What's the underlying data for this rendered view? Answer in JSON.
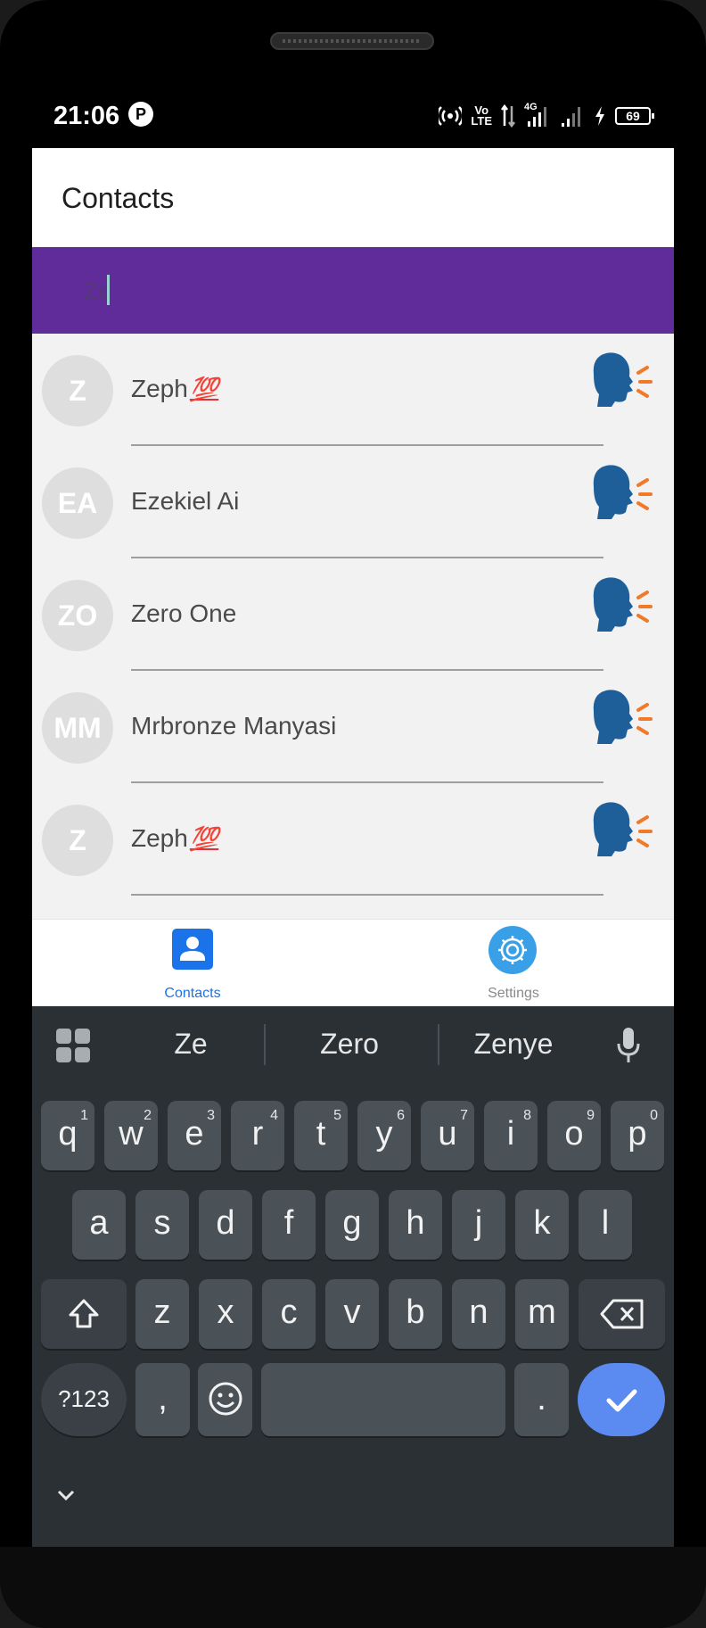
{
  "statusbar": {
    "time": "21:06",
    "notif_glyph": "P",
    "network_top": "Vo",
    "network_bottom": "LTE",
    "network_type": "4G",
    "battery": "69"
  },
  "appbar": {
    "title": "Contacts"
  },
  "search": {
    "value": "Ze",
    "placeholder": ""
  },
  "contacts": [
    {
      "initials": "Z",
      "name": "Zeph",
      "emoji": "💯"
    },
    {
      "initials": "EA",
      "name": "Ezekiel Ai",
      "emoji": ""
    },
    {
      "initials": "ZO",
      "name": "Zero  One",
      "emoji": ""
    },
    {
      "initials": "MM",
      "name": "Mrbronze Manyasi",
      "emoji": ""
    },
    {
      "initials": "Z",
      "name": "Zeph",
      "emoji": "💯"
    }
  ],
  "tabs": [
    {
      "label": "Contacts",
      "active": true,
      "color": "#1a73e8"
    },
    {
      "label": "Settings",
      "active": false,
      "color": "#8a8a8a"
    }
  ],
  "keyboard": {
    "suggestions": [
      "Ze",
      "Zero",
      "Zenye"
    ],
    "row1": [
      {
        "k": "q",
        "h": "1"
      },
      {
        "k": "w",
        "h": "2"
      },
      {
        "k": "e",
        "h": "3"
      },
      {
        "k": "r",
        "h": "4"
      },
      {
        "k": "t",
        "h": "5"
      },
      {
        "k": "y",
        "h": "6"
      },
      {
        "k": "u",
        "h": "7"
      },
      {
        "k": "i",
        "h": "8"
      },
      {
        "k": "o",
        "h": "9"
      },
      {
        "k": "p",
        "h": "0"
      }
    ],
    "row2": [
      "a",
      "s",
      "d",
      "f",
      "g",
      "h",
      "j",
      "k",
      "l"
    ],
    "row3": [
      "z",
      "x",
      "c",
      "v",
      "b",
      "n",
      "m"
    ],
    "symbols_key": "?123",
    "comma_key": ",",
    "period_key": "."
  },
  "colors": {
    "search_bar": "#5f2c99",
    "speak_head": "#1e5f9a",
    "speak_waves": "#f07a2a",
    "enter_key": "#5b8bf0"
  }
}
